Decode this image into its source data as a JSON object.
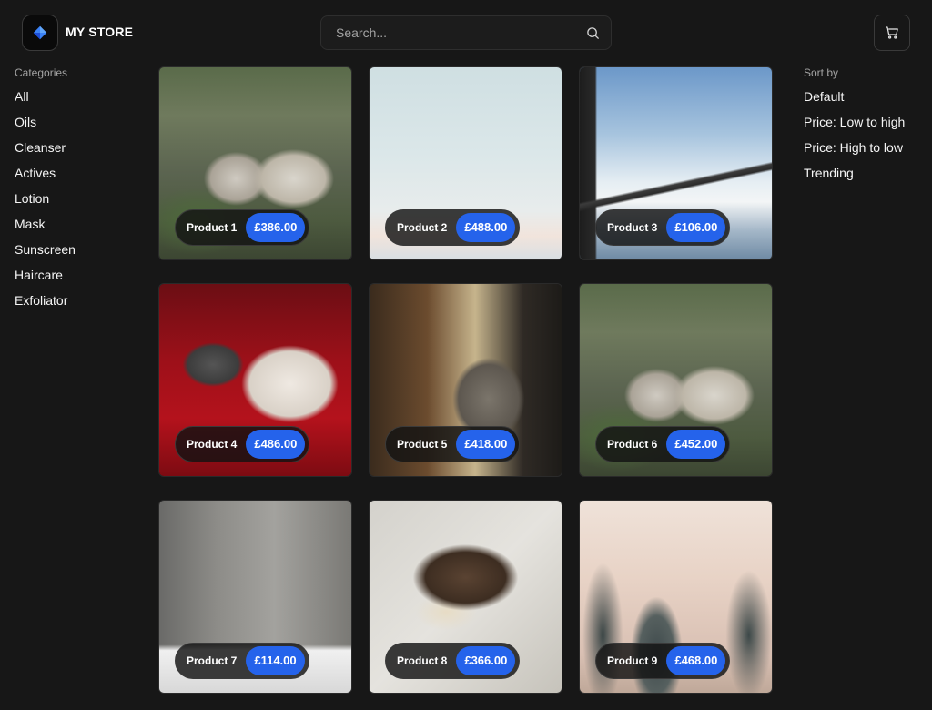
{
  "header": {
    "store_name": "MY STORE",
    "search_placeholder": "Search...",
    "logo_icon": "diamond-logo-icon",
    "cart_icon": "cart-icon",
    "search_icon": "search-icon"
  },
  "categories": {
    "heading": "Categories",
    "items": [
      {
        "label": "All",
        "active": true
      },
      {
        "label": "Oils"
      },
      {
        "label": "Cleanser"
      },
      {
        "label": "Actives"
      },
      {
        "label": "Lotion"
      },
      {
        "label": "Mask"
      },
      {
        "label": "Sunscreen"
      },
      {
        "label": "Haircare"
      },
      {
        "label": "Exfoliator"
      }
    ]
  },
  "sort": {
    "heading": "Sort by",
    "items": [
      {
        "label": "Default",
        "active": true
      },
      {
        "label": "Price: Low to high"
      },
      {
        "label": "Price: High to low"
      },
      {
        "label": "Trending"
      }
    ]
  },
  "products": [
    {
      "name": "Product 1",
      "price": "£386.00"
    },
    {
      "name": "Product 2",
      "price": "£488.00"
    },
    {
      "name": "Product 3",
      "price": "£106.00"
    },
    {
      "name": "Product 4",
      "price": "£486.00"
    },
    {
      "name": "Product 5",
      "price": "£418.00"
    },
    {
      "name": "Product 6",
      "price": "£452.00"
    },
    {
      "name": "Product 7",
      "price": "£114.00"
    },
    {
      "name": "Product 8",
      "price": "£366.00"
    },
    {
      "name": "Product 9",
      "price": "£468.00"
    }
  ],
  "colors": {
    "background": "#171717",
    "price_badge": "#2563eb",
    "logo_accent": "#3b82f6"
  }
}
